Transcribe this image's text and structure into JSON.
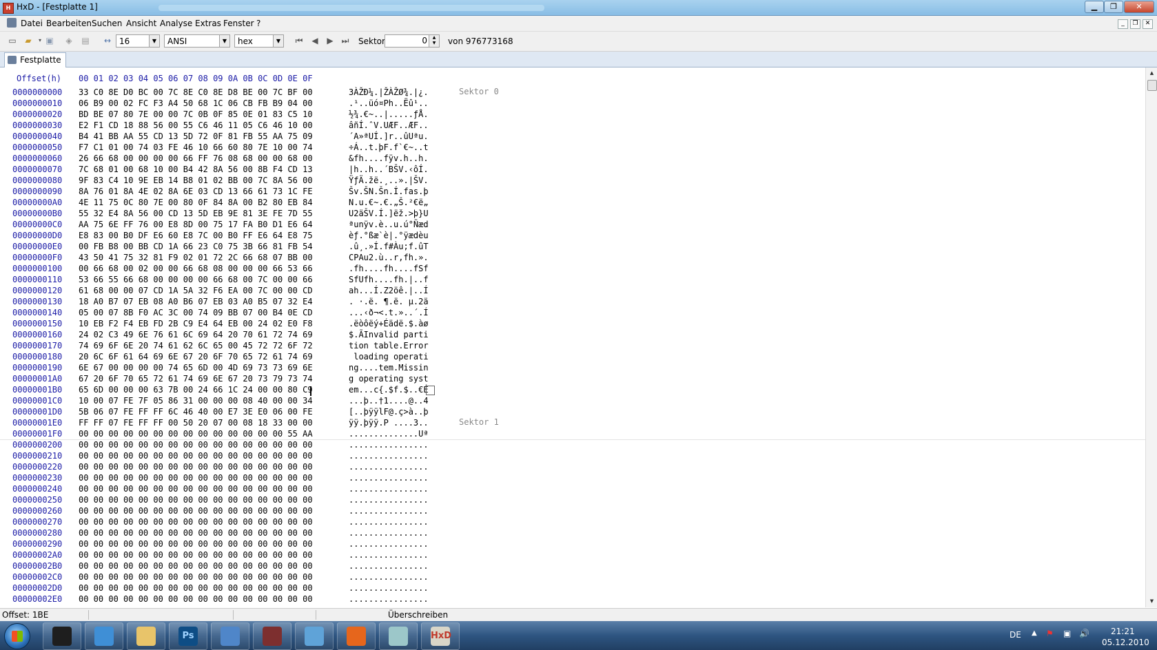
{
  "window": {
    "title": "HxD - [Festplatte 1]",
    "minimize": "▁",
    "maximize": "❐",
    "close": "✕"
  },
  "menu": {
    "items": [
      "Datei",
      "Bearbeiten",
      "Suchen",
      "Ansicht",
      "Analyse",
      "Extras",
      "Fenster",
      "?"
    ]
  },
  "toolbar": {
    "bytes_per_row": "16",
    "charset": "ANSI",
    "offset_base": "hex",
    "sector_label": "Sektor",
    "sector_value": "0",
    "sector_total": "von 976773168"
  },
  "tab": {
    "label": "Festplatte 1"
  },
  "editor": {
    "header_offset": "Offset(h)",
    "header_columns": "00 01 02 03 04 05 06 07 08 09 0A 0B 0C 0D 0E 0F",
    "rows": [
      {
        "offset": "0000000000",
        "hex": "33 C0 8E D0 BC 00 7C 8E C0 8E D8 BE 00 7C BF 00",
        "ascii": "3ÀŽĐ¼.|ŽÀŽØ¾.|¿."
      },
      {
        "offset": "0000000010",
        "hex": "06 B9 00 02 FC F3 A4 50 68 1C 06 CB FB B9 04 00",
        "ascii": ".¹..üó¤Ph..Ëû¹.."
      },
      {
        "offset": "0000000020",
        "hex": "BD BE 07 80 7E 00 00 7C 0B 0F 85 0E 01 83 C5 10",
        "ascii": "½¾.€~..|.....ƒÅ."
      },
      {
        "offset": "0000000030",
        "hex": "E2 F1 CD 18 88 56 00 55 C6 46 11 05 C6 46 10 00",
        "ascii": "âñÍ.ˆV.UÆF..ÆF.."
      },
      {
        "offset": "0000000040",
        "hex": "B4 41 BB AA 55 CD 13 5D 72 0F 81 FB 55 AA 75 09",
        "ascii": "´A»ªUÍ.]r..ûUªu."
      },
      {
        "offset": "0000000050",
        "hex": "F7 C1 01 00 74 03 FE 46 10 66 60 80 7E 10 00 74",
        "ascii": "÷Á..t.þF.f`€~..t"
      },
      {
        "offset": "0000000060",
        "hex": "26 66 68 00 00 00 00 66 FF 76 08 68 00 00 68 00",
        "ascii": "&fh....fÿv.h..h."
      },
      {
        "offset": "0000000070",
        "hex": "7C 68 01 00 68 10 00 B4 42 8A 56 00 8B F4 CD 13",
        "ascii": "|h..h..´BŠV.‹ôÍ."
      },
      {
        "offset": "0000000080",
        "hex": "9F 83 C4 10 9E EB 14 B8 01 02 BB 00 7C 8A 56 00",
        "ascii": "ŸƒÄ.žë.¸..».|ŠV."
      },
      {
        "offset": "0000000090",
        "hex": "8A 76 01 8A 4E 02 8A 6E 03 CD 13 66 61 73 1C FE",
        "ascii": "Šv.ŠN.Šn.Í.fas.þ"
      },
      {
        "offset": "00000000A0",
        "hex": "4E 11 75 0C 80 7E 00 80 0F 84 8A 00 B2 80 EB 84",
        "ascii": "N.u.€~.€.„Š.²€ë„"
      },
      {
        "offset": "00000000B0",
        "hex": "55 32 E4 8A 56 00 CD 13 5D EB 9E 81 3E FE 7D 55",
        "ascii": "U2äŠV.Í.]ëž.>þ}U"
      },
      {
        "offset": "00000000C0",
        "hex": "AA 75 6E FF 76 00 E8 8D 00 75 17 FA B0 D1 E6 64",
        "ascii": "ªunÿv.è..u.ú°Ñæd"
      },
      {
        "offset": "00000000D0",
        "hex": "E8 83 00 B0 DF E6 60 E8 7C 00 B0 FF E6 64 E8 75",
        "ascii": "èƒ.°ßæ`è|.°ÿædèu"
      },
      {
        "offset": "00000000E0",
        "hex": "00 FB B8 00 BB CD 1A 66 23 C0 75 3B 66 81 FB 54",
        "ascii": ".û¸.»Í.f#Àu;f.ûT"
      },
      {
        "offset": "00000000F0",
        "hex": "43 50 41 75 32 81 F9 02 01 72 2C 66 68 07 BB 00",
        "ascii": "CPAu2.ù..r,fh.»."
      },
      {
        "offset": "0000000100",
        "hex": "00 66 68 00 02 00 00 66 68 08 00 00 00 66 53 66",
        "ascii": ".fh....fh....fSf"
      },
      {
        "offset": "0000000110",
        "hex": "53 66 55 66 68 00 00 00 00 66 68 00 7C 00 00 66",
        "ascii": "SfUfh....fh.|..f"
      },
      {
        "offset": "0000000120",
        "hex": "61 68 00 00 07 CD 1A 5A 32 F6 EA 00 7C 00 00 CD",
        "ascii": "ah...Í.Z2öê.|..Í"
      },
      {
        "offset": "0000000130",
        "hex": "18 A0 B7 07 EB 08 A0 B6 07 EB 03 A0 B5 07 32 E4",
        "ascii": ". ·.ë. ¶.ë. µ.2ä"
      },
      {
        "offset": "0000000140",
        "hex": "05 00 07 8B F0 AC 3C 00 74 09 BB 07 00 B4 0E CD",
        "ascii": "...‹ð¬<.t.»..´.Í"
      },
      {
        "offset": "0000000150",
        "hex": "10 EB F2 F4 EB FD 2B C9 E4 64 EB 00 24 02 E0 F8",
        "ascii": ".ëòôëý+Éädë.$.àø"
      },
      {
        "offset": "0000000160",
        "hex": "24 02 C3 49 6E 76 61 6C 69 64 20 70 61 72 74 69",
        "ascii": "$.ÃInvalid parti"
      },
      {
        "offset": "0000000170",
        "hex": "74 69 6F 6E 20 74 61 62 6C 65 00 45 72 72 6F 72",
        "ascii": "tion table.Error"
      },
      {
        "offset": "0000000180",
        "hex": "20 6C 6F 61 64 69 6E 67 20 6F 70 65 72 61 74 69",
        "ascii": " loading operati"
      },
      {
        "offset": "0000000190",
        "hex": "6E 67 00 00 00 00 74 65 6D 00 4D 69 73 73 69 6E",
        "ascii": "ng....tem.Missin"
      },
      {
        "offset": "00000001A0",
        "hex": "67 20 6F 70 65 72 61 74 69 6E 67 20 73 79 73 74",
        "ascii": "g operating syst"
      },
      {
        "offset": "00000001B0",
        "hex": "65 6D 00 00 00 63 7B 00 24 66 1C 24 00 00 80 C9",
        "ascii": "em...c{.$f.$..€É"
      },
      {
        "offset": "00000001C0",
        "hex": "10 00 07 FE 7F 05 86 31 00 00 00 08 40 00 00 34",
        "ascii": "...þ..†1....@..4"
      },
      {
        "offset": "00000001D0",
        "hex": "5B 06 07 FE FF FF 6C 46 40 00 E7 3E E0 06 00 FE",
        "ascii": "[..þÿÿlF@.ç>à..þ"
      },
      {
        "offset": "00000001E0",
        "hex": "FF FF 07 FE FF FF 00 50 20 07 00 08 18 33 00 00",
        "ascii": "ÿÿ.þÿÿ.P ....3.."
      },
      {
        "offset": "00000001F0",
        "hex": "00 00 00 00 00 00 00 00 00 00 00 00 00 00 55 AA",
        "ascii": "..............Uª"
      },
      {
        "offset": "0000000200",
        "hex": "00 00 00 00 00 00 00 00 00 00 00 00 00 00 00 00",
        "ascii": "................"
      },
      {
        "offset": "0000000210",
        "hex": "00 00 00 00 00 00 00 00 00 00 00 00 00 00 00 00",
        "ascii": "................"
      },
      {
        "offset": "0000000220",
        "hex": "00 00 00 00 00 00 00 00 00 00 00 00 00 00 00 00",
        "ascii": "................"
      },
      {
        "offset": "0000000230",
        "hex": "00 00 00 00 00 00 00 00 00 00 00 00 00 00 00 00",
        "ascii": "................"
      },
      {
        "offset": "0000000240",
        "hex": "00 00 00 00 00 00 00 00 00 00 00 00 00 00 00 00",
        "ascii": "................"
      },
      {
        "offset": "0000000250",
        "hex": "00 00 00 00 00 00 00 00 00 00 00 00 00 00 00 00",
        "ascii": "................"
      },
      {
        "offset": "0000000260",
        "hex": "00 00 00 00 00 00 00 00 00 00 00 00 00 00 00 00",
        "ascii": "................"
      },
      {
        "offset": "0000000270",
        "hex": "00 00 00 00 00 00 00 00 00 00 00 00 00 00 00 00",
        "ascii": "................"
      },
      {
        "offset": "0000000280",
        "hex": "00 00 00 00 00 00 00 00 00 00 00 00 00 00 00 00",
        "ascii": "................"
      },
      {
        "offset": "0000000290",
        "hex": "00 00 00 00 00 00 00 00 00 00 00 00 00 00 00 00",
        "ascii": "................"
      },
      {
        "offset": "00000002A0",
        "hex": "00 00 00 00 00 00 00 00 00 00 00 00 00 00 00 00",
        "ascii": "................"
      },
      {
        "offset": "00000002B0",
        "hex": "00 00 00 00 00 00 00 00 00 00 00 00 00 00 00 00",
        "ascii": "................"
      },
      {
        "offset": "00000002C0",
        "hex": "00 00 00 00 00 00 00 00 00 00 00 00 00 00 00 00",
        "ascii": "................"
      },
      {
        "offset": "00000002D0",
        "hex": "00 00 00 00 00 00 00 00 00 00 00 00 00 00 00 00",
        "ascii": "................"
      },
      {
        "offset": "00000002E0",
        "hex": "00 00 00 00 00 00 00 00 00 00 00 00 00 00 00 00",
        "ascii": "................"
      }
    ],
    "sector_labels": [
      "Sektor 0",
      "Sektor 1"
    ]
  },
  "status": {
    "offset": "Offset: 1BE",
    "mode": "Überschreiben"
  },
  "taskbar": {
    "apps": [
      {
        "name": "explorer-pinned",
        "color": "#1e1e1e"
      },
      {
        "name": "browser",
        "color": "#3f8fd6"
      },
      {
        "name": "file-explorer",
        "color": "#e8c46a"
      },
      {
        "name": "photoshop",
        "color": "#0e4d85"
      },
      {
        "name": "app-ring",
        "color": "#4f86c9"
      },
      {
        "name": "winrar",
        "color": "#7d2f2f"
      },
      {
        "name": "messenger",
        "color": "#5fa3d8"
      },
      {
        "name": "firefox",
        "color": "#e6661c"
      },
      {
        "name": "notepad",
        "color": "#9cc7c9"
      },
      {
        "name": "hxd",
        "color": "#d9d6c8"
      }
    ],
    "photoshop_label": "Ps",
    "hxd_label": "HxD",
    "language": "DE",
    "time": "21:21",
    "date": "05.12.2010"
  }
}
